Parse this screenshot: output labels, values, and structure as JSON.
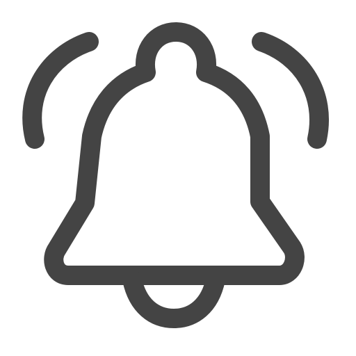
{
  "icon": {
    "name": "notification-bell-icon",
    "parts": [
      "left-ring-wave",
      "bell-body",
      "bell-clapper",
      "right-ring-wave"
    ],
    "colors": {
      "stroke": "#444444",
      "background": "#ffffff"
    }
  }
}
